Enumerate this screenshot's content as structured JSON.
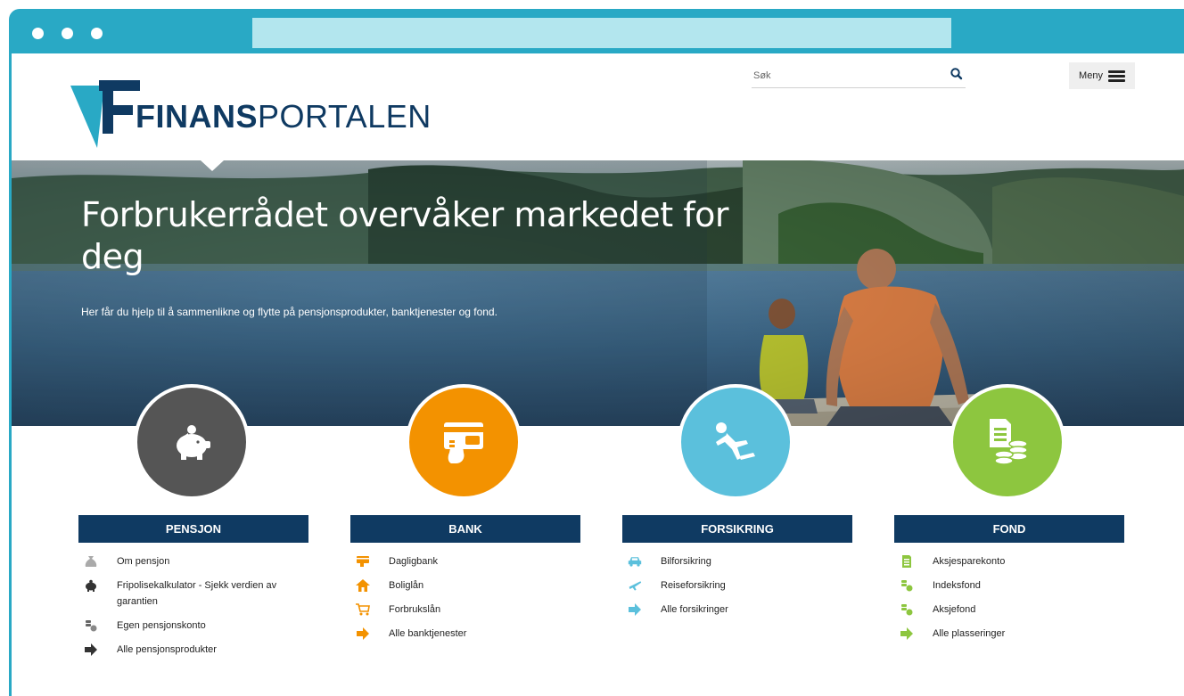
{
  "brand": {
    "logo_bold": "FINANS",
    "logo_light": "PORTALEN"
  },
  "header": {
    "search_placeholder": "Søk",
    "menu_label": "Meny"
  },
  "hero": {
    "title": "Forbrukerrådet overvåker markedet for deg",
    "subtitle": "Her får du hjelp til å sammenlikne og flytte på pensjonsprodukter, banktjenester og fond."
  },
  "categories": [
    {
      "title": "PENSJON",
      "color": "#555555",
      "icon": "piggy-bank-icon",
      "links": [
        {
          "label": "Om pensjon",
          "icon": "moneybag-icon"
        },
        {
          "label": "Fripolisekalkulator - Sjekk verdien av garantien",
          "icon": "piggy-bank-icon"
        },
        {
          "label": "Egen pensjonskonto",
          "icon": "coins-icon"
        },
        {
          "label": "Alle pensjonsprodukter",
          "icon": "arrow-right-icon"
        }
      ]
    },
    {
      "title": "BANK",
      "color": "#f39200",
      "icon": "card-hand-icon",
      "links": [
        {
          "label": "Dagligbank",
          "icon": "card-hand-icon"
        },
        {
          "label": "Boliglån",
          "icon": "house-icon"
        },
        {
          "label": "Forbrukslån",
          "icon": "cart-icon"
        },
        {
          "label": "Alle banktjenester",
          "icon": "arrow-right-icon"
        }
      ]
    },
    {
      "title": "FORSIKRING",
      "color": "#5bc0dc",
      "icon": "falling-person-icon",
      "links": [
        {
          "label": "Bilforsikring",
          "icon": "car-icon"
        },
        {
          "label": "Reiseforsikring",
          "icon": "airplane-icon"
        },
        {
          "label": "Alle forsikringer",
          "icon": "arrow-right-icon"
        }
      ]
    },
    {
      "title": "FOND",
      "color": "#8dc63f",
      "icon": "document-coins-icon",
      "links": [
        {
          "label": "Aksjesparekonto",
          "icon": "document-icon"
        },
        {
          "label": "Indeksfond",
          "icon": "coins-icon"
        },
        {
          "label": "Aksjefond",
          "icon": "coins-icon"
        },
        {
          "label": "Alle plasseringer",
          "icon": "arrow-right-icon"
        }
      ]
    }
  ]
}
